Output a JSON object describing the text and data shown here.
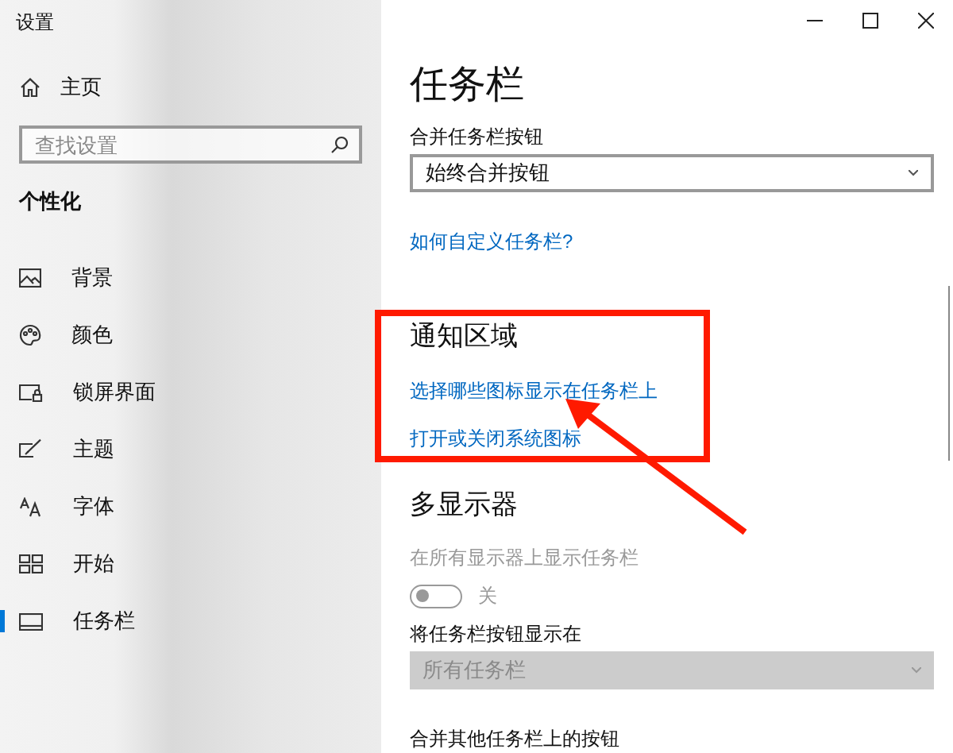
{
  "window": {
    "title": "设置"
  },
  "sidebar": {
    "home": "主页",
    "search": {
      "placeholder": "查找设置"
    },
    "section": "个性化",
    "items": [
      {
        "label": "背景",
        "selected": false
      },
      {
        "label": "颜色",
        "selected": false
      },
      {
        "label": "锁屏界面",
        "selected": false
      },
      {
        "label": "主题",
        "selected": false
      },
      {
        "label": "字体",
        "selected": false
      },
      {
        "label": "开始",
        "selected": false
      },
      {
        "label": "任务栏",
        "selected": true
      }
    ]
  },
  "page": {
    "title": "任务栏",
    "sections": [
      {
        "kind": "dropdown",
        "label": "合并任务栏按钮",
        "value": "始终合并按钮",
        "disabled": false
      },
      {
        "kind": "link",
        "text": "如何自定义任务栏?"
      },
      {
        "kind": "heading",
        "text": "通知区域"
      },
      {
        "kind": "link",
        "text": "选择哪些图标显示在任务栏上"
      },
      {
        "kind": "link",
        "text": "打开或关闭系统图标"
      },
      {
        "kind": "heading",
        "text": "多显示器"
      },
      {
        "kind": "toggle",
        "label": "在所有显示器上显示任务栏",
        "on": false,
        "state_text": "关",
        "disabled": true
      },
      {
        "kind": "dropdown",
        "label": "将任务栏按钮显示在",
        "value": "所有任务栏",
        "disabled": true
      },
      {
        "kind": "label",
        "text": "合并其他任务栏上的按钮"
      }
    ]
  }
}
